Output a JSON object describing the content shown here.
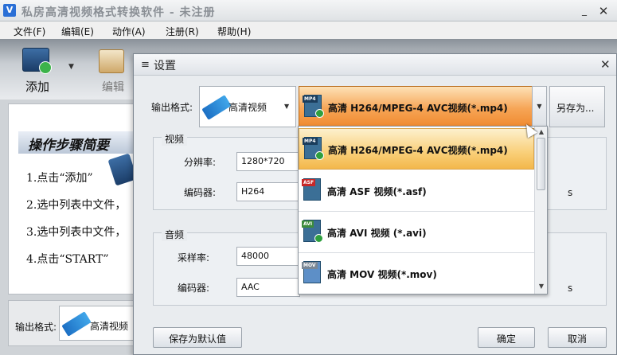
{
  "app": {
    "title": "私房高清视频格式转换软件 - 未注册",
    "icon": "app-logo-icon"
  },
  "menu": [
    {
      "label": "文件(F)"
    },
    {
      "label": "编辑(E)"
    },
    {
      "label": "动作(A)"
    },
    {
      "label": "注册(R)"
    },
    {
      "label": "帮助(H)"
    }
  ],
  "toolbar": {
    "add_label": "添加",
    "edit_label": "编辑"
  },
  "steps": {
    "title": "操作步骤简要",
    "items": [
      "1.点击“添加”",
      "2.选中列表中文件，",
      "3.选中列表中文件，",
      "4.点击“START”"
    ]
  },
  "bottom": {
    "output_label": "输出格式:",
    "format_name": "高清视频"
  },
  "dialog": {
    "title": "设置",
    "output_label": "输出格式:",
    "category": "高清视频",
    "selected_format": "高清 H264/MPEG-4 AVC视频(*.mp4)",
    "saveas_label": "另存为...",
    "video": {
      "group_title": "视频",
      "resolution_label": "分辨率:",
      "resolution_value": "1280*720",
      "encoder_label": "编码器:",
      "encoder_value": "H264",
      "suffix": "s"
    },
    "audio": {
      "group_title": "音频",
      "samplerate_label": "采样率:",
      "samplerate_value": "48000",
      "encoder_label": "编码器:",
      "encoder_value": "AAC",
      "suffix": "s"
    },
    "buttons": {
      "save_default": "保存为默认值",
      "ok": "确定",
      "cancel": "取消"
    }
  },
  "dropdown": {
    "items": [
      {
        "tag": "MP4",
        "label": "高清 H264/MPEG-4 AVC视频(*.mp4)",
        "selected": true
      },
      {
        "tag": "ASF",
        "label": "高清 ASF 视频(*.asf)",
        "selected": false
      },
      {
        "tag": "AVI",
        "label": "高清 AVI 视频 (*.avi)",
        "selected": false
      },
      {
        "tag": "MOV",
        "label": "高清 MOV 视频(*.mov)",
        "selected": false
      }
    ]
  },
  "colors": {
    "selection_orange": "#f6a556",
    "selection_light": "#fde1b6",
    "film_blue": "#1c6fc4"
  }
}
